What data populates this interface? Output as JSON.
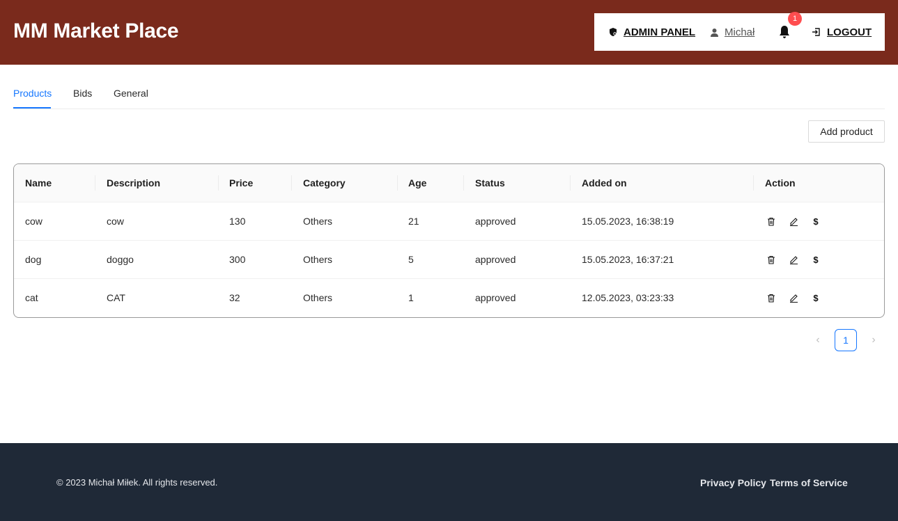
{
  "header": {
    "brand": "MM Market Place",
    "admin_label": "ADMIN PANEL",
    "user_label": "Michał",
    "notification_count": "1",
    "logout_label": "LOGOUT"
  },
  "tabs": [
    "Products",
    "Bids",
    "General"
  ],
  "active_tab": "Products",
  "add_button": "Add product",
  "table": {
    "columns": [
      "Name",
      "Description",
      "Price",
      "Category",
      "Age",
      "Status",
      "Added on",
      "Action"
    ],
    "rows": [
      {
        "name": "cow",
        "description": "cow",
        "price": "130",
        "category": "Others",
        "age": "21",
        "status": "approved",
        "added_on": "15.05.2023, 16:38:19",
        "price_action": "$"
      },
      {
        "name": "dog",
        "description": "doggo",
        "price": "300",
        "category": "Others",
        "age": "5",
        "status": "approved",
        "added_on": "15.05.2023, 16:37:21",
        "price_action": "$"
      },
      {
        "name": "cat",
        "description": "CAT",
        "price": "32",
        "category": "Others",
        "age": "1",
        "status": "approved",
        "added_on": "12.05.2023, 03:23:33",
        "price_action": "$"
      }
    ]
  },
  "pagination": {
    "current_page": "1",
    "prev": "‹",
    "next": "›"
  },
  "footer": {
    "copyright": "© 2023 Michał Miłek. All rights reserved.",
    "privacy": "Privacy Policy",
    "terms": "Terms of Service"
  },
  "colors": {
    "header_bg": "#7a2a1c",
    "accent": "#1677ff",
    "footer_bg": "#1f2937",
    "badge": "#ff4d4f"
  }
}
